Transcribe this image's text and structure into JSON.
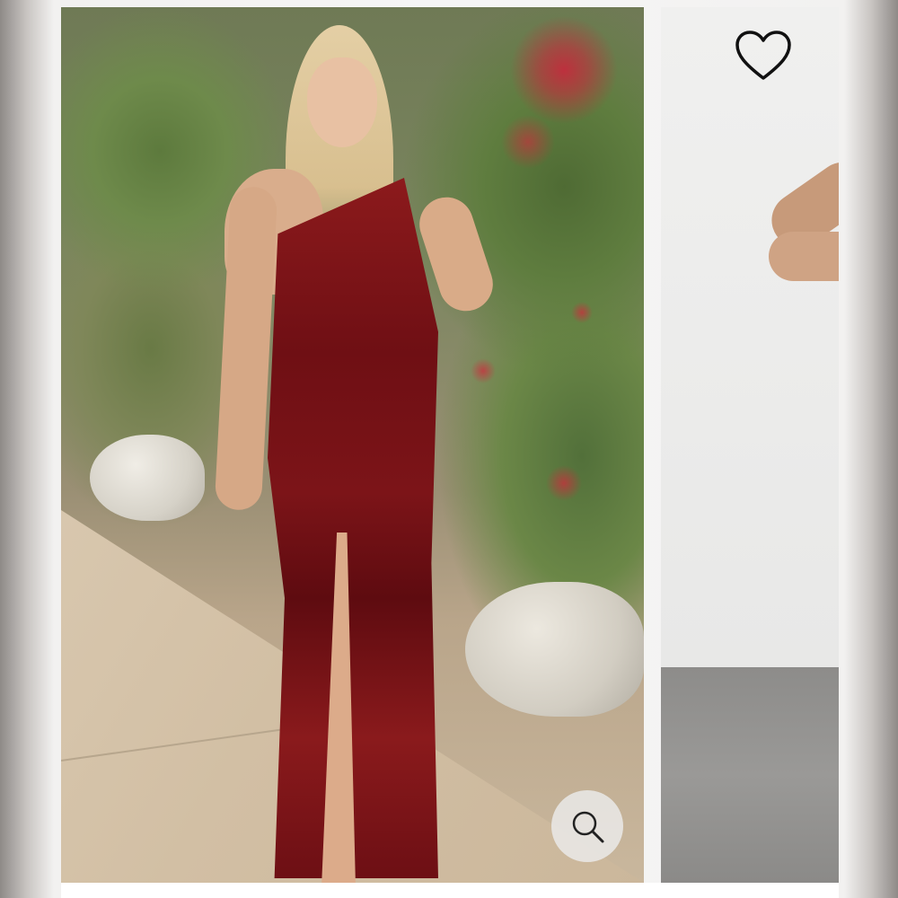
{
  "gallery": {
    "main_image": {
      "icon_search": "magnifier-icon"
    },
    "side_image": {
      "icon_favorite": "heart-outline-icon"
    }
  },
  "colors": {
    "dress": "#7a1216",
    "background": "#f6f6f6",
    "icon": "#111111"
  }
}
